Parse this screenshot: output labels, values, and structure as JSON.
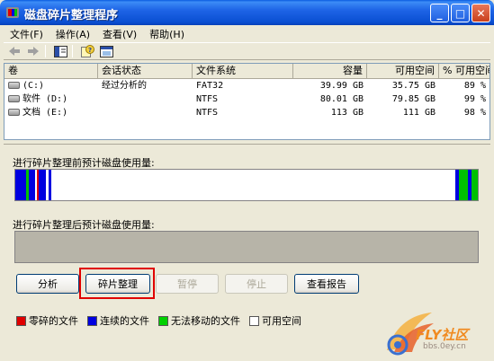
{
  "window": {
    "title": "磁盘碎片整理程序"
  },
  "menu": [
    "文件(F)",
    "操作(A)",
    "查看(V)",
    "帮助(H)"
  ],
  "list": {
    "columns": [
      "卷",
      "会话状态",
      "文件系统",
      "容量",
      "可用空间",
      "% 可用空间"
    ],
    "rows": [
      {
        "volume": "(C:)",
        "status": "经过分析的",
        "fs": "FAT32",
        "capacity": "39.99 GB",
        "free": "35.75 GB",
        "pct": "89 %"
      },
      {
        "volume": "软件 (D:)",
        "status": "",
        "fs": "NTFS",
        "capacity": "80.01 GB",
        "free": "79.85 GB",
        "pct": "99 %"
      },
      {
        "volume": "文档 (E:)",
        "status": "",
        "fs": "NTFS",
        "capacity": "113 GB",
        "free": "111 GB",
        "pct": "98 %"
      }
    ]
  },
  "panels": {
    "before_label": "进行碎片整理前预计磁盘使用量:",
    "after_label": "进行碎片整理后预计磁盘使用量:"
  },
  "buttons": {
    "analyze": "分析",
    "defrag": "碎片整理",
    "pause": "暂停",
    "stop": "停止",
    "report": "查看报告"
  },
  "legend": [
    {
      "label": "零碎的文件",
      "color": "#E00000"
    },
    {
      "label": "连续的文件",
      "color": "#0000E0"
    },
    {
      "label": "无法移动的文件",
      "color": "#00D000"
    },
    {
      "label": "可用空间",
      "color": "#FFFFFF"
    }
  ],
  "watermark": {
    "brand": "FLY社区",
    "url": "bbs.0ey.cn"
  }
}
